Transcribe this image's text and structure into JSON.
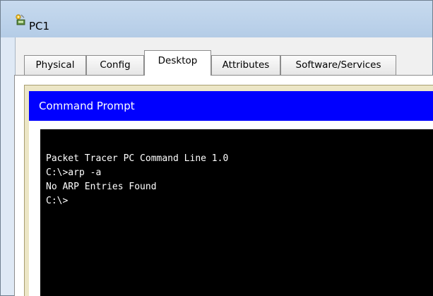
{
  "window": {
    "title": "PC1",
    "icon": "pc-device-icon"
  },
  "tabs": [
    {
      "label": "Physical",
      "active": false
    },
    {
      "label": "Config",
      "active": false
    },
    {
      "label": "Desktop",
      "active": true
    },
    {
      "label": "Attributes",
      "active": false
    },
    {
      "label": "Software/Services",
      "active": false
    }
  ],
  "command_prompt": {
    "header": "Command Prompt",
    "header_color": "#0000ff",
    "lines": [
      "Packet Tracer PC Command Line 1.0",
      "C:\\>arp -a",
      "No ARP Entries Found",
      "C:\\>"
    ]
  }
}
